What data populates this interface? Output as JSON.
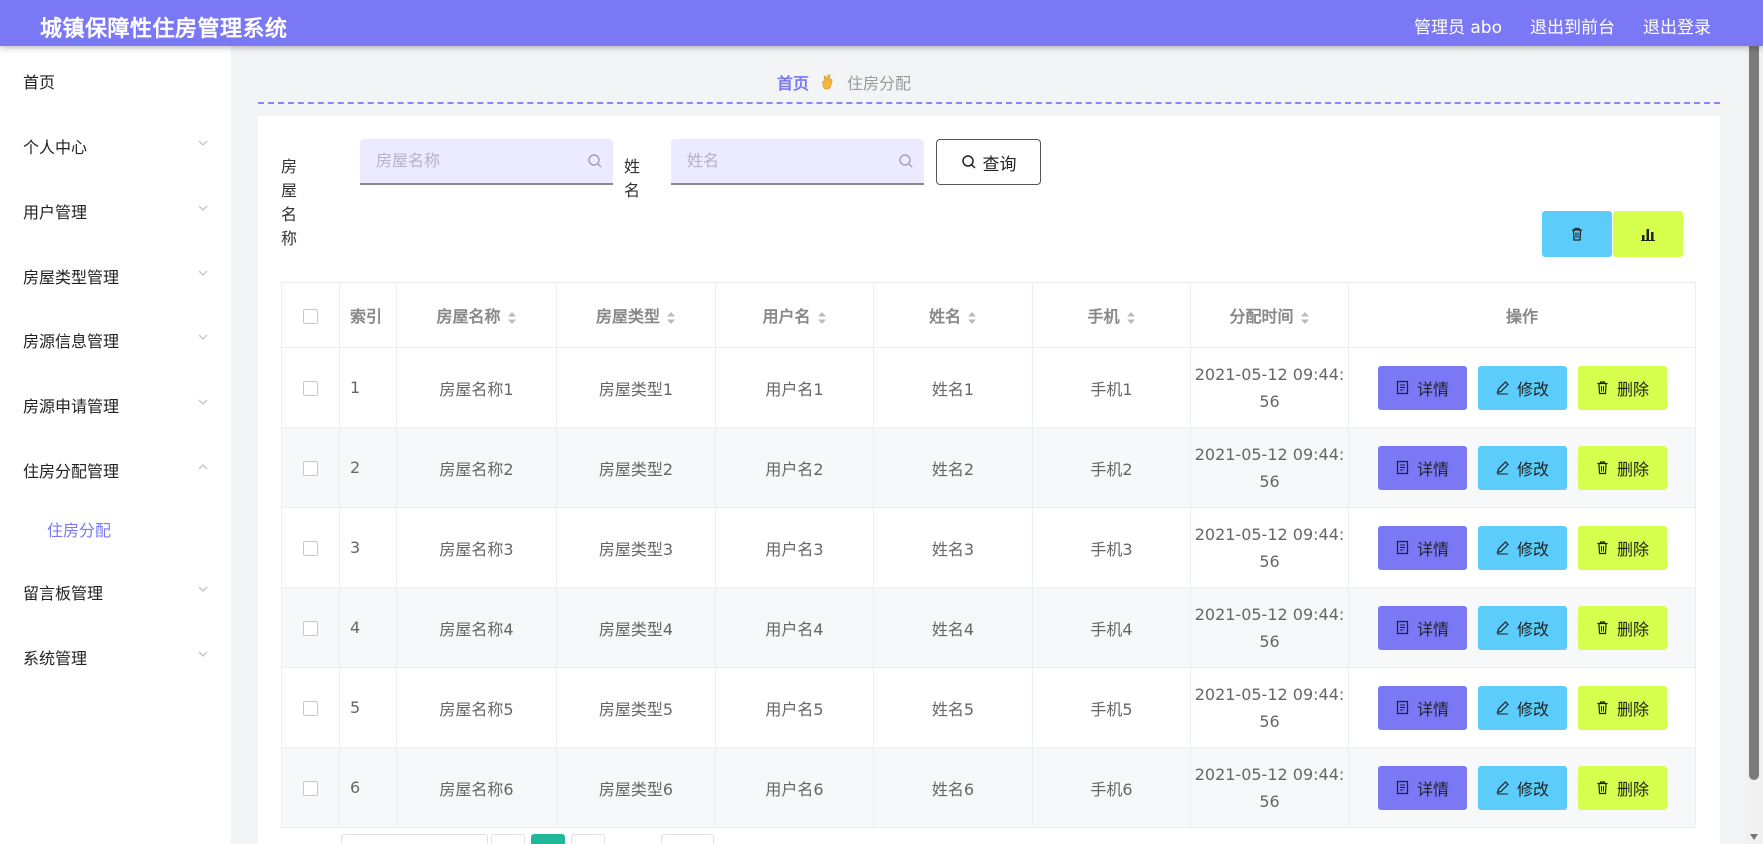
{
  "header": {
    "app_title": "城镇保障性住房管理系统",
    "admin_label": "管理员 abo",
    "front_link": "退出到前台",
    "logout_link": "退出登录"
  },
  "sidebar": {
    "items": [
      {
        "label": "首页"
      },
      {
        "label": "个人中心"
      },
      {
        "label": "用户管理"
      },
      {
        "label": "房屋类型管理"
      },
      {
        "label": "房源信息管理"
      },
      {
        "label": "房源申请管理"
      },
      {
        "label": "住房分配管理"
      },
      {
        "label": "留言板管理"
      },
      {
        "label": "系统管理"
      }
    ],
    "sub_item": "住房分配"
  },
  "breadcrumb": {
    "home": "首页",
    "current": "住房分配"
  },
  "search": {
    "house_label": "房屋名称",
    "house_placeholder": "房屋名称",
    "name_label": "姓名",
    "name_placeholder": "姓名",
    "query_label": "查询"
  },
  "table": {
    "headers": [
      "索引",
      "房屋名称",
      "房屋类型",
      "用户名",
      "姓名",
      "手机",
      "分配时间",
      "操作"
    ],
    "rows": [
      {
        "index": "1",
        "house": "房屋名称1",
        "type": "房屋类型1",
        "user": "用户名1",
        "name": "姓名1",
        "phone": "手机1",
        "time_a": "2021-05-12 09:44:",
        "time_b": "56"
      },
      {
        "index": "2",
        "house": "房屋名称2",
        "type": "房屋类型2",
        "user": "用户名2",
        "name": "姓名2",
        "phone": "手机2",
        "time_a": "2021-05-12 09:44:",
        "time_b": "56"
      },
      {
        "index": "3",
        "house": "房屋名称3",
        "type": "房屋类型3",
        "user": "用户名3",
        "name": "姓名3",
        "phone": "手机3",
        "time_a": "2021-05-12 09:44:",
        "time_b": "56"
      },
      {
        "index": "4",
        "house": "房屋名称4",
        "type": "房屋类型4",
        "user": "用户名4",
        "name": "姓名4",
        "phone": "手机4",
        "time_a": "2021-05-12 09:44:",
        "time_b": "56"
      },
      {
        "index": "5",
        "house": "房屋名称5",
        "type": "房屋类型5",
        "user": "用户名5",
        "name": "姓名5",
        "phone": "手机5",
        "time_a": "2021-05-12 09:44:",
        "time_b": "56"
      },
      {
        "index": "6",
        "house": "房屋名称6",
        "type": "房屋类型6",
        "user": "用户名6",
        "name": "姓名6",
        "phone": "手机6",
        "time_a": "2021-05-12 09:44:",
        "time_b": "56"
      }
    ],
    "actions": {
      "detail": "详情",
      "edit": "修改",
      "delete": "删除"
    }
  },
  "icons": {
    "breadcrumb_separator": "hand-emoji-icon",
    "search_field": "search-icon",
    "query_button": "search-icon",
    "toolbar_delete": "trash-icon",
    "toolbar_chart": "bar-chart-icon",
    "detail": "document-icon",
    "edit": "pencil-icon",
    "delete": "trash-icon"
  },
  "colors": {
    "primary": "#7b78f5",
    "info": "#5ccdfb",
    "danger": "#d6ff4d",
    "pager_active": "#1fb89a"
  }
}
